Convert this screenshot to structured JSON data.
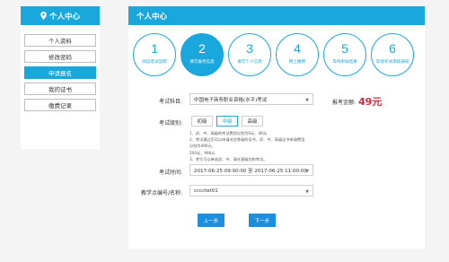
{
  "sidebar": {
    "title": "个人中心",
    "items": [
      {
        "label": "个人资料"
      },
      {
        "label": "修改密码"
      },
      {
        "label": "申请报名"
      },
      {
        "label": "我的证书"
      },
      {
        "label": "缴费记录"
      }
    ]
  },
  "main": {
    "title": "个人中心",
    "steps": [
      {
        "num": "1",
        "label": "阅读考试说明"
      },
      {
        "num": "2",
        "label": "填写报考信息"
      },
      {
        "num": "3",
        "label": "填写个人信息"
      },
      {
        "num": "4",
        "label": "网上缴费"
      },
      {
        "num": "5",
        "label": "等待审核结果"
      },
      {
        "num": "6",
        "label": "等待考试审核通知"
      }
    ],
    "active_step": 2,
    "form": {
      "subject_label": "考试科目:",
      "subject_value": "中国电子商务职业资格(水平)考试",
      "fee_label": "报考金额:",
      "fee_value": "49元",
      "level_label": "考试级别:",
      "levels": [
        "初级",
        "中级",
        "高级"
      ],
      "active_level": "中级",
      "notes": [
        "1、初、中、高级的考试费用分别为0元、49元",
        "2、考试通过后可以申请对应等级的证书，初、中、高级证书申请费用分别为490元、",
        "500元，990元",
        "3、考生可以单选初、中、高任意级别的考试。"
      ],
      "time_label": "考试时间:",
      "time_value": "2017-06-25 09:00:00 至 2017-06-25 11:00:00",
      "center_label": "教学点编号/名称:",
      "center_value": "cccctet01"
    },
    "buttons": {
      "prev": "上一步",
      "next": "下一步"
    }
  },
  "colors": {
    "accent": "#1aa7dc",
    "fee": "#e2263c",
    "button": "#1a8fe0"
  },
  "icons": {
    "sidebar_title_icon": "location-pin-icon"
  }
}
